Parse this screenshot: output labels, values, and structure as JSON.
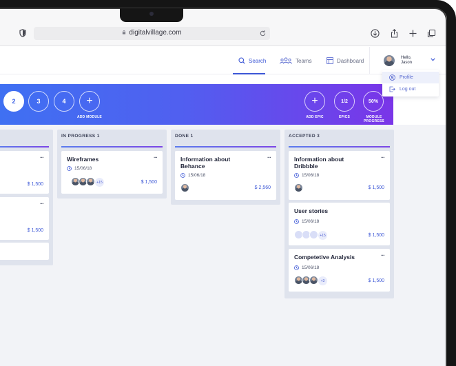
{
  "browser": {
    "url": "digitalvillage.com",
    "icons": [
      "shield-icon",
      "lock-icon",
      "reload-icon",
      "download-icon",
      "share-icon",
      "new-tab-icon",
      "tabs-icon"
    ]
  },
  "header": {
    "nav": [
      {
        "label": "Search",
        "icon": "search-icon",
        "active": true
      },
      {
        "label": "Teams",
        "icon": "teams-icon",
        "active": false
      },
      {
        "label": "Dashboard",
        "icon": "dashboard-icon",
        "active": false
      }
    ],
    "user": {
      "greeting": "Hello,",
      "name": "Jason"
    }
  },
  "dropdown": {
    "items": [
      {
        "label": "Profile",
        "icon": "profile-icon"
      },
      {
        "label": "Log out",
        "icon": "logout-icon"
      }
    ]
  },
  "banner": {
    "modules": [
      "2",
      "3",
      "4"
    ],
    "add_module_label": "ADD MODULE",
    "add_epic_label": "ADD EPIC",
    "epics_value": "1/2",
    "epics_label": "EPICS",
    "progress_value": "50%",
    "progress_label": "MODULE PROGRESS"
  },
  "columns": [
    {
      "title": "",
      "cards": [
        {
          "title": "",
          "price": "$ 1,500"
        },
        {
          "title": "",
          "price": "$ 1,500"
        },
        {
          "title": "",
          "price": ""
        }
      ]
    },
    {
      "title": "IN PROGRESS  1",
      "cards": [
        {
          "title": "Wireframes",
          "date": "15/06/18",
          "price": "$ 1,500",
          "extra": "+15"
        }
      ]
    },
    {
      "title": "DONE  1",
      "cards": [
        {
          "title": "Information about Behance",
          "date": "15/06/18",
          "price": "$ 2,560"
        }
      ]
    },
    {
      "title": "ACCEPTED  3",
      "cards": [
        {
          "title": "Information about Dribbble",
          "date": "15/06/18",
          "price": "$ 1,500"
        },
        {
          "title": "User stories",
          "date": "15/06/18",
          "price": "$ 1,500",
          "extra": "+15"
        },
        {
          "title": "Competetive Analysis",
          "date": "15/06/18",
          "price": "$ 1,500",
          "extra": "+3"
        }
      ]
    }
  ],
  "card_menu": "···",
  "colors": {
    "accent": "#3c57d6",
    "banner_start": "#3f70f2",
    "banner_end": "#7a35e8"
  }
}
